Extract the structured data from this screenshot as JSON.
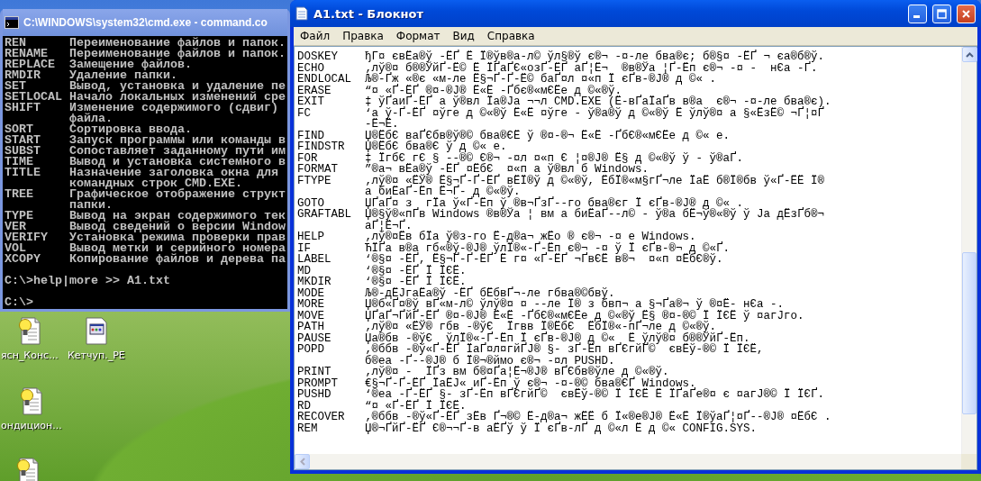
{
  "cmd_window": {
    "title": "C:\\WINDOWS\\system32\\cmd.exe - command.co",
    "entries": [
      {
        "command": "REN",
        "lines": [
          "Переименование файлов и папок."
        ]
      },
      {
        "command": "RENAME",
        "lines": [
          "Переименование файлов и папок."
        ]
      },
      {
        "command": "REPLACE",
        "lines": [
          "Замещение файлов."
        ]
      },
      {
        "command": "RMDIR",
        "lines": [
          "Удаление папки."
        ]
      },
      {
        "command": "SET",
        "lines": [
          "Вывод, установка и удаление пе"
        ]
      },
      {
        "command": "SETLOCAL",
        "lines": [
          "Начало локальных изменений сре"
        ]
      },
      {
        "command": "SHIFT",
        "lines": [
          "Изменение содержимого (сдвиг)",
          "файла."
        ]
      },
      {
        "command": "SORT",
        "lines": [
          "Сортировка ввода."
        ]
      },
      {
        "command": "START",
        "lines": [
          "Запуск программы или команды в"
        ]
      },
      {
        "command": "SUBST",
        "lines": [
          "Сопоставляет заданному пути им"
        ]
      },
      {
        "command": "TIME",
        "lines": [
          "Вывод и установка системного в"
        ]
      },
      {
        "command": "TITLE",
        "lines": [
          "Назначение заголовка окна для",
          "командных строк CMD.EXE."
        ]
      },
      {
        "command": "TREE",
        "lines": [
          "Графическое отображение структ",
          "папки."
        ]
      },
      {
        "command": "TYPE",
        "lines": [
          "Вывод на экран содержимого тек"
        ]
      },
      {
        "command": "VER",
        "lines": [
          "Вывод сведений о версии Window"
        ]
      },
      {
        "command": "VERIFY",
        "lines": [
          "Установка режима проверки прав"
        ]
      },
      {
        "command": "VOL",
        "lines": [
          "Вывод метки и серийного номера"
        ]
      },
      {
        "command": "XCOPY",
        "lines": [
          "Копирование файлов и дерева па"
        ]
      }
    ],
    "prompt_lines": [
      "C:\\>help|more >> A1.txt",
      "C:\\>"
    ]
  },
  "notepad": {
    "title": "A1.txt - Блокнот",
    "menu": [
      "Файл",
      "Правка",
      "Формат",
      "Вид",
      "Справка"
    ],
    "entries": [
      {
        "command": "DOSKEY",
        "lines": [
          "ђГ¤ євЁа®ў -ЁҐ Ё Ї®ўв®а-л© ўл§®ў є®¬ -¤-ле бва®є; б®§¤ -ЁҐ ¬ єа®б®ў."
        ]
      },
      {
        "command": "ECHO",
        "lines": [
          "‚лў®¤ б®®ЎйҐ-Ё© Ё ЇҐаҐЄ«озҐ-ЁҐ аҐ¦Ё¬  ®в®Ўа ¦Ґ-Ёп є®¬ -¤ -  нЄа -Ґ."
        ]
      },
      {
        "command": "ENDLOCAL",
        "lines": [
          "Љ®-Ґж «®є «м-ле Ё§¬Ґ-Ґ-Ё© баҐ¤л ¤«п Ї єҐв-®J® д ©« ."
        ]
      },
      {
        "command": "ERASE",
        "lines": [
          "“¤ «Ґ-ЁҐ ®¤-®J® Ё«Ё -Ґбє®«мЄЁе д ©«®ў."
        ]
      },
      {
        "command": "EXIT",
        "lines": [
          "‡ ўҐаиҐ-ЁҐ а ў®вл Їа®Jа ¬¬л CMD.EXE (Ё-вҐаЇаҐв в®а  є®¬ -¤-ле бва®є)."
        ]
      },
      {
        "command": "FC",
        "lines": [
          "‘а ў-Ґ-ЁҐ ¤ўге д ©«®ў Ё«Ё ¤ўге - ў®а®ў д ©«®ў Ё ўлў®¤ а §«ЁзЁ© ¬Ґ¦¤Ґ",
          "-Ё¬Ё."
        ]
      },
      {
        "command": "FIND",
        "lines": [
          "Џ®ЁбЄ ваҐЄбв®ў®© бва®ЄЁ ў ®¤-®¬ Ё«Ё -ҐбЄ®«мЄЁе д ©« е."
        ]
      },
      {
        "command": "FINDSTR",
        "lines": [
          "Џ®ЁбЄ бва®Є ў д ©« е."
        ]
      },
      {
        "command": "FOR",
        "lines": [
          "‡ ЇгбЄ гЄ § --®© Є®¬ -¤л ¤«п Є ¦¤®J® Ё§ д ©«®ў ў - ў®аҐ."
        ]
      },
      {
        "command": "FORMAT",
        "lines": [
          "”®а¬ вЁа®ў -ЁҐ ¤ЁбЄ  ¤«п а ў®вл б Windows."
        ]
      },
      {
        "command": "FTYPE",
        "lines": [
          "‚лў®¤ «ЁЎ® Ё§¬Ґ-Ґ-ЁҐ вЁЇ®ў д ©«®ў, ЁбЇ®«м§гҐ¬ле ЇаЁ б®Ї®бв ў«Ґ-ЁЁ Ї®",
          "а биЁаҐ-Ёп Ё¬Ґ- д ©«®ў."
        ]
      },
      {
        "command": "GOTO",
        "lines": [
          "ЏҐаҐ¤ з  гЇа ў«Ґ-Ёп ў ®в¬ҐзҐ--го бва®єг Ї єҐв-®J® д ©« ."
        ]
      },
      {
        "command": "GRAFTABL",
        "lines": [
          "Џ®§ў®«пҐв Windows ®в®Ўа ¦ вм а биЁаҐ--л© - ў®а бЁ¬ў®«®ў ў Jа дЁзҐб®¬",
          "аҐ¦Ё¬Ґ."
        ]
      },
      {
        "command": "HELP",
        "lines": [
          "‚лў®¤Ёв бЇа ў®з-го Ё-д®а¬ жЁо ® є®¬ -¤ е Windows."
        ]
      },
      {
        "command": "IF",
        "lines": [
          "ЋЇҐа в®а гб«®ў-®J® ўлЇ®«-Ґ-Ёп є®¬ -¤ ў Ї єҐв-®¬ д ©«Ґ."
        ]
      },
      {
        "command": "LABEL",
        "lines": [
          "‘®§¤ -ЁҐ, Ё§¬Ґ-Ґ-ЁҐ Ё г¤ «Ґ-ЁҐ ¬ҐвЄЁ в®¬  ¤«п ¤ЁбЄ®ў."
        ]
      },
      {
        "command": "MD",
        "lines": [
          "‘®§¤ -ЁҐ Ї ЇЄЁ."
        ]
      },
      {
        "command": "MKDIR",
        "lines": [
          "‘®§¤ -ЁҐ Ї ЇЄЁ."
        ]
      },
      {
        "command": "MODE",
        "lines": [
          "Љ®-дЁJгаЁа®ў -ЁҐ бЁбвҐ¬-ле гбва®©бвў."
        ]
      },
      {
        "command": "MORE",
        "lines": [
          "Џ®б«Ґ¤®ў вҐ«м-л© ўлў®¤ ¤ --ле Ї® з бвп¬ а §¬Ґа®¬ ў ®¤Ё- нЄа -."
        ]
      },
      {
        "command": "MOVE",
        "lines": [
          "ЏҐаҐ¬ҐйҐ-ЁҐ ®¤-®J® Ё«Ё -ҐбЄ®«мЄЁе д ©«®ў Ё§ ®¤-®© Ї ЇЄЁ ў ¤агJго."
        ]
      },
      {
        "command": "PATH",
        "lines": [
          "‚лў®¤ «ЁЎ® гбв -®ўЄ  Їгвв Ї®ЁбЄ  ЁбЇ®«-пҐ¬ле д ©«®ў."
        ]
      },
      {
        "command": "PAUSE",
        "lines": [
          "Џа®бв -®ўЄ  ўлЇ®«-Ґ-Ёп Ї єҐв-®J® д ©«  Ё ўлў®¤ б®®ЎйҐ-Ёп."
        ]
      },
      {
        "command": "POPD",
        "lines": [
          "‚®ббв -®ў«Ґ-ЁҐ ЇаҐ¤л¤гйҐJ® §- зҐ-Ёп вҐЄгйҐ©  євЁў-®© Ї ЇЄЁ,",
          "б®еа -Ґ--®J® б Ї®¬®ймо є®¬ -¤л PUSHD."
        ]
      },
      {
        "command": "PRINT",
        "lines": [
          "‚лў®¤ -  ЇҐз вм б®¤Ґа¦Ё¬®J® вҐЄбв®ўле д ©«®ў."
        ]
      },
      {
        "command": "PROMPT",
        "lines": [
          "€§¬Ґ-Ґ-ЁҐ ЇаЁJ« иҐ-Ёп ў є®¬ -¤-®© бва®ЄҐ Windows."
        ]
      },
      {
        "command": "PUSHD",
        "lines": [
          "‘®еа -Ґ-ЁҐ §- зҐ-Ёп вҐЄгйҐ©  євЁў-®© Ї ЇЄЁ Ё ЇҐаҐе®¤ є ¤агJ®© Ї ЇЄҐ."
        ]
      },
      {
        "command": "RD",
        "lines": [
          "“¤ «Ґ-ЁҐ Ї ЇЄЁ."
        ]
      },
      {
        "command": "RECOVER",
        "lines": [
          "‚®ббв -®ў«Ґ-ЁҐ зЁв Ґ¬®© Ё-д®а¬ жЁЁ б Ї«®е®J® Ё«Ё Ї®ўаҐ¦¤Ґ--®J® ¤ЁбЄ ."
        ]
      },
      {
        "command": "REM",
        "lines": [
          "Џ®¬ҐйҐ-ЁҐ Є®¬¬Ґ-в аЁҐў ў Ї єҐв-лҐ д ©«л Ё д ©« CONFIG.SYS."
        ]
      }
    ]
  },
  "desktop_icons": [
    {
      "kind": "tip",
      "label": "ясн_Конс..."
    },
    {
      "kind": "app",
      "label": "Кетчуп._PE"
    },
    {
      "kind": "tip",
      "label": "ондицион..."
    },
    {
      "kind": "tip"
    }
  ]
}
